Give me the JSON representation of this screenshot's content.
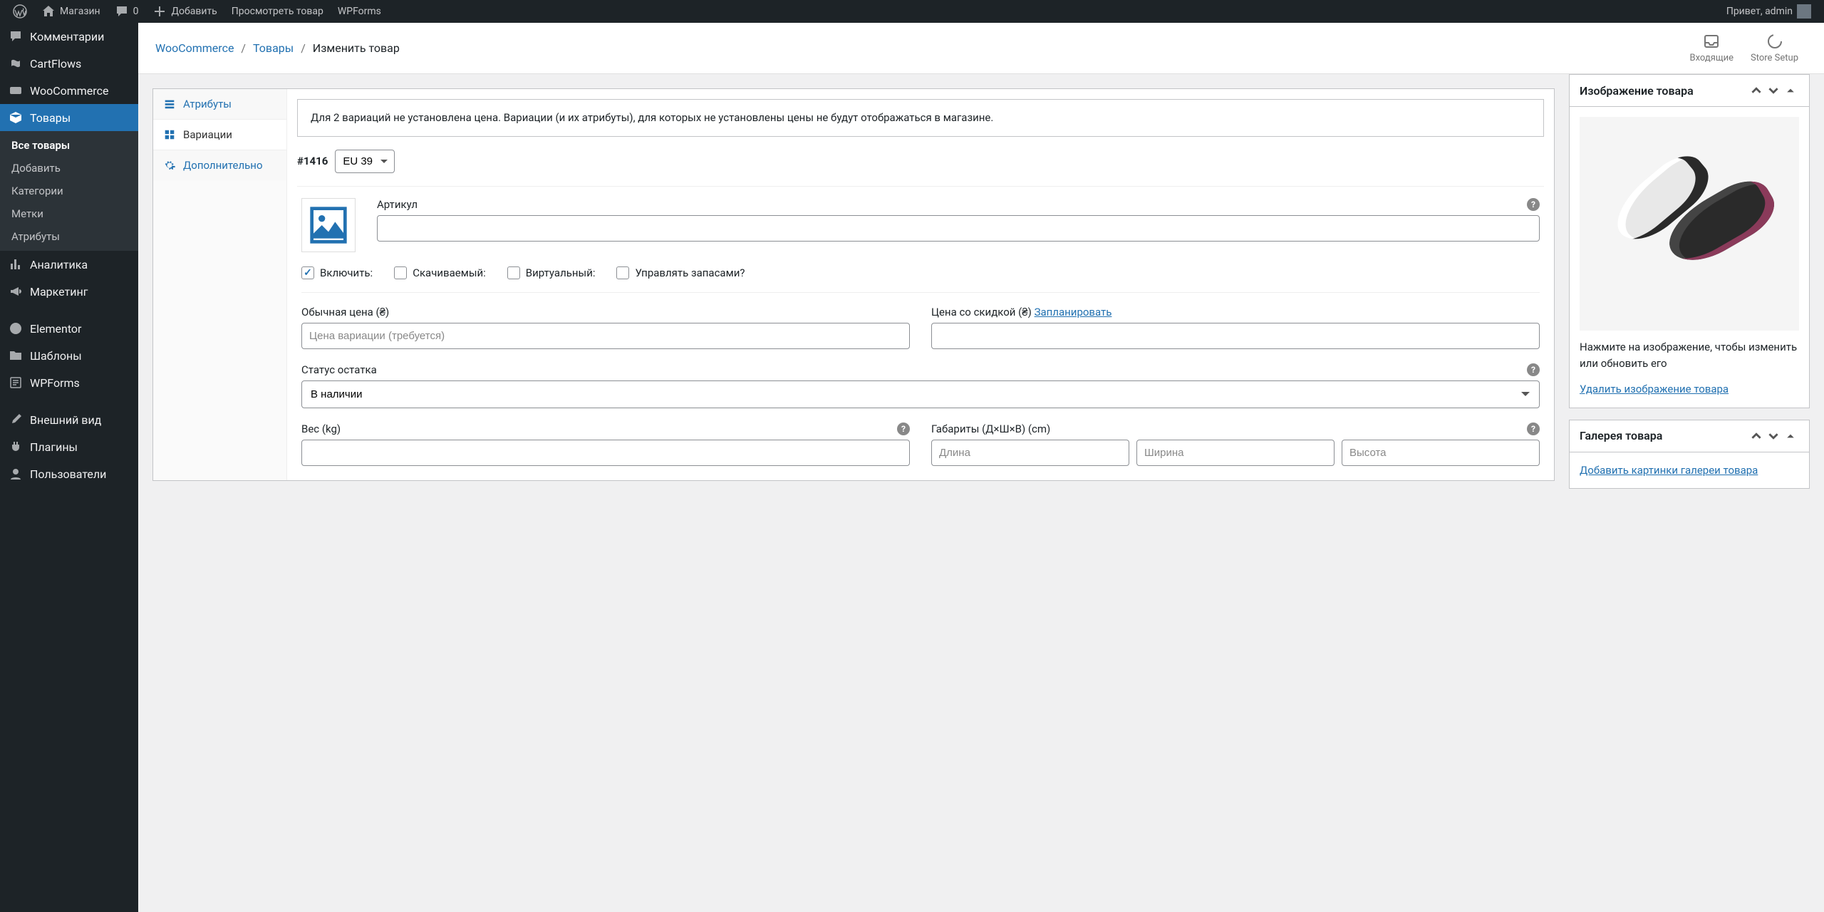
{
  "adminbar": {
    "site_name": "Магазин",
    "comments_count": "0",
    "add_new": "Добавить",
    "view_product": "Просмотреть товар",
    "wpforms": "WPForms",
    "greeting": "Привет, admin"
  },
  "adminmenu": {
    "comments": "Комментарии",
    "cartflows": "CartFlows",
    "woocommerce": "WooCommerce",
    "products": "Товары",
    "submenu": {
      "all_products": "Все товары",
      "add_new": "Добавить",
      "categories": "Категории",
      "tags": "Метки",
      "attributes": "Атрибуты"
    },
    "analytics": "Аналитика",
    "marketing": "Маркетинг",
    "elementor": "Elementor",
    "templates": "Шаблоны",
    "wpforms": "WPForms",
    "appearance": "Внешний вид",
    "plugins": "Плагины",
    "users": "Пользователи"
  },
  "wc_header": {
    "crumb1": "WooCommerce",
    "crumb2": "Товары",
    "crumb3": "Изменить товар",
    "inbox": "Входящие",
    "store_setup": "Store Setup"
  },
  "pd_tabs": {
    "attributes": "Атрибуты",
    "variations": "Вариации",
    "advanced": "Дополнительно"
  },
  "variation": {
    "notice": "Для 2 вариаций не установлена цена. Вариации (и их атрибуты), для которых не установлены цены не будут отображаться в магазине.",
    "id": "#1416",
    "size": "EU 39",
    "sku_label": "Артикул",
    "enable_label": "Включить:",
    "downloadable_label": "Скачиваемый:",
    "virtual_label": "Виртуальный:",
    "manage_stock_label": "Управлять запасами?",
    "regular_price_label": "Обычная цена (₴)",
    "regular_price_placeholder": "Цена вариации (требуется)",
    "sale_price_label": "Цена со скидкой (₴)",
    "schedule_link": "Запланировать",
    "stock_status_label": "Статус остатка",
    "stock_status_value": "В наличии",
    "weight_label": "Вес (kg)",
    "dimensions_label": "Габариты (Д×Ш×В) (cm)",
    "dim_length": "Длина",
    "dim_width": "Ширина",
    "dim_height": "Высота"
  },
  "sidebar": {
    "product_image": {
      "title": "Изображение товара",
      "hint": "Нажмите на изображение, чтобы изменить или обновить его",
      "remove_link": "Удалить изображение товара"
    },
    "gallery": {
      "title": "Галерея товара",
      "add_link": "Добавить картинки галереи товара"
    }
  }
}
